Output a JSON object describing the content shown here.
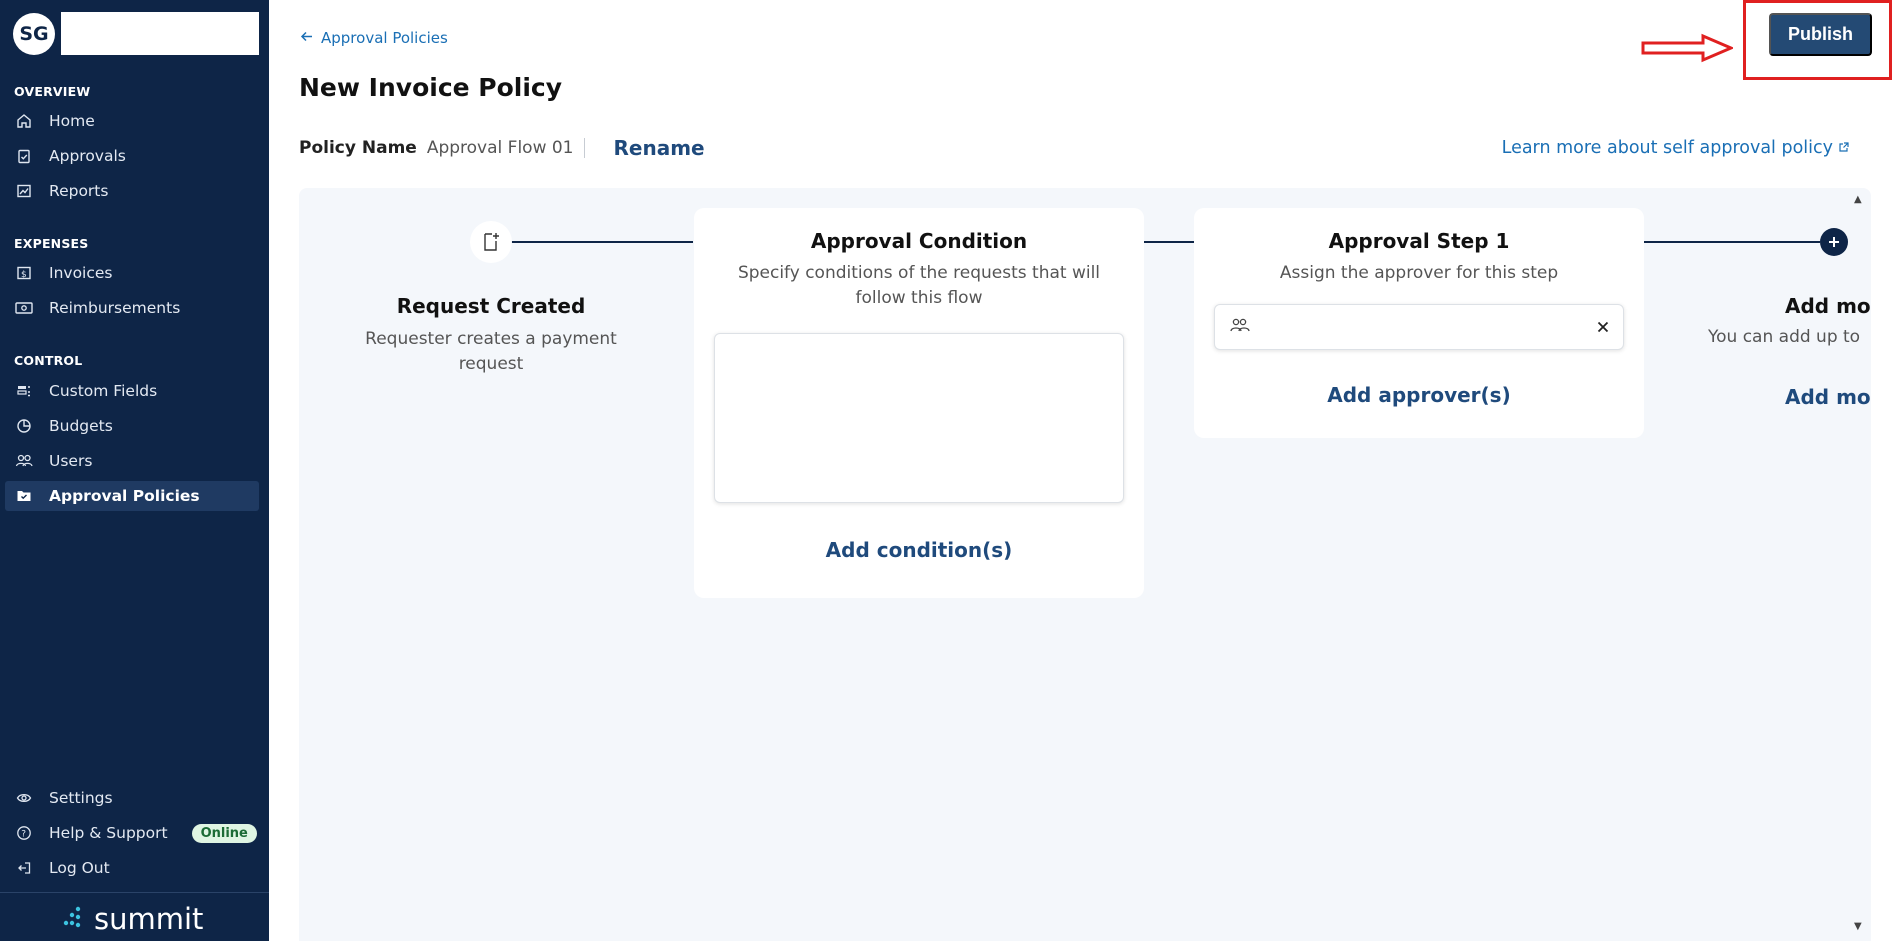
{
  "sidebar": {
    "avatar_initials": "SG",
    "sections": {
      "overview": "OVERVIEW",
      "expenses": "EXPENSES",
      "control": "CONTROL"
    },
    "items": {
      "home": "Home",
      "approvals": "Approvals",
      "reports": "Reports",
      "invoices": "Invoices",
      "reimbursements": "Reimbursements",
      "custom_fields": "Custom Fields",
      "budgets": "Budgets",
      "users": "Users",
      "approval_policies": "Approval Policies",
      "settings": "Settings",
      "help_support": "Help & Support",
      "log_out": "Log Out"
    },
    "status_badge": "Online",
    "logo_text": "summit",
    "active_item": "Approval Policies"
  },
  "header": {
    "back_link": "Approval Policies",
    "title": "New Invoice Policy",
    "publish_label": "Publish"
  },
  "policy": {
    "name_label": "Policy Name",
    "name_value": "Approval Flow 01",
    "rename_label": "Rename",
    "learn_more": "Learn more about self approval policy"
  },
  "flow": {
    "request_created": {
      "title": "Request Created",
      "description": "Requester creates a payment request"
    },
    "approval_condition": {
      "title": "Approval Condition",
      "description": "Specify conditions of the requests that will follow this flow",
      "action": "Add condition(s)"
    },
    "approval_step": {
      "title": "Approval Step 1",
      "description": "Assign the approver for this step",
      "action": "Add approver(s)"
    },
    "add_more": {
      "title": "Add mo",
      "description": "You can add up to",
      "action": "Add mo"
    }
  },
  "colors": {
    "sidebar_bg": "#0e2547",
    "primary_button": "#244a74",
    "link": "#1a6fb5",
    "annotation_red": "#e02020",
    "canvas_bg": "#f4f7fb"
  }
}
